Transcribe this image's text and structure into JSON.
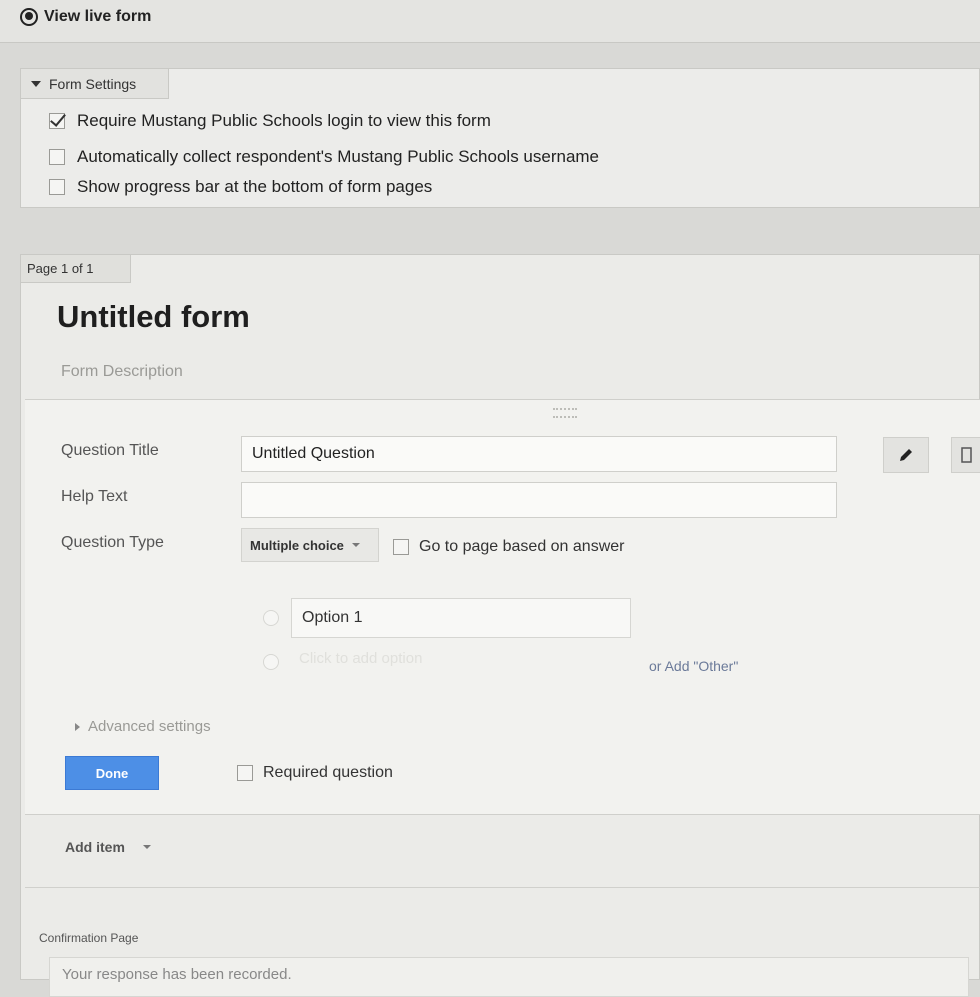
{
  "topbar": {
    "view_live_form": "View live form"
  },
  "form_settings": {
    "tab_label": "Form Settings",
    "options": [
      {
        "label": "Require Mustang Public Schools login to view this form",
        "checked": true
      },
      {
        "label": "Automatically collect respondent's Mustang Public Schools username",
        "checked": false
      },
      {
        "label": "Show progress bar at the bottom of form pages",
        "checked": false
      }
    ]
  },
  "page": {
    "tab_label": "Page 1 of 1",
    "form_title": "Untitled form",
    "form_description_placeholder": "Form Description"
  },
  "question": {
    "title_label": "Question Title",
    "title_value": "Untitled Question",
    "help_label": "Help Text",
    "help_value": "",
    "type_label": "Question Type",
    "type_value": "Multiple choice",
    "goto_label": "Go to page based on answer",
    "option_1": "Option 1",
    "add_option_placeholder": "Click to add option",
    "add_other": "or Add \"Other\"",
    "advanced_settings": "Advanced settings",
    "done_label": "Done",
    "required_label": "Required question"
  },
  "add_item": {
    "label": "Add item"
  },
  "confirmation": {
    "label": "Confirmation Page",
    "message": "Your response has been recorded."
  },
  "colors": {
    "done_button": "#4d8fe6",
    "add_other_link": "#6b7a99"
  }
}
